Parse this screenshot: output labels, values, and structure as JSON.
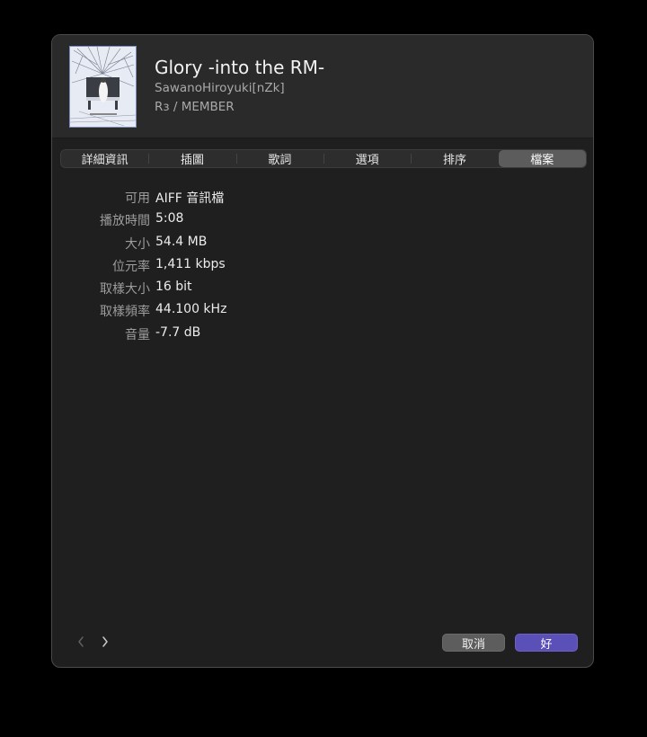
{
  "header": {
    "artwork_icon": "album-artwork",
    "title": "Glory -into the RM-",
    "artist": "SawanoHiroyuki[nZk]",
    "album": "Rɜ / MEMBER"
  },
  "tabs": [
    {
      "label": "詳細資訊",
      "selected": false
    },
    {
      "label": "插圖",
      "selected": false
    },
    {
      "label": "歌詞",
      "selected": false
    },
    {
      "label": "選項",
      "selected": false
    },
    {
      "label": "排序",
      "selected": false
    },
    {
      "label": "檔案",
      "selected": true
    }
  ],
  "file_info": [
    {
      "label": "可用",
      "value": "AIFF 音訊檔"
    },
    {
      "label": "播放時間",
      "value": "5:08"
    },
    {
      "label": "大小",
      "value": "54.4 MB"
    },
    {
      "label": "位元率",
      "value": "1,411 kbps"
    },
    {
      "label": "取樣大小",
      "value": "16 bit"
    },
    {
      "label": "取樣頻率",
      "value": "44.100 kHz"
    },
    {
      "label": "音量",
      "value": "-7.7 dB"
    }
  ],
  "footer": {
    "prev_icon": "chevron-left-icon",
    "next_icon": "chevron-right-icon",
    "cancel_label": "取消",
    "ok_label": "好"
  },
  "colors": {
    "window_bg": "#1f1f1f",
    "header_bg": "#2a2a2a",
    "accent": "#5b4fb8",
    "selected_tab": "#5c5c5c"
  }
}
